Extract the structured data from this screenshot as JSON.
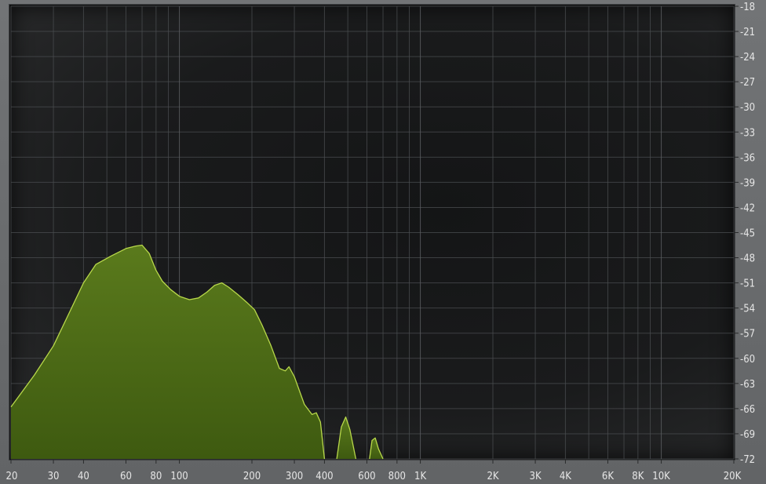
{
  "chart_data": {
    "type": "area",
    "x_scale": "log",
    "y_unit": "dB",
    "xlim": [
      20,
      20000
    ],
    "ylim": [
      -72,
      -18
    ],
    "grid": true,
    "x_ticks": [
      {
        "value": 20,
        "label": "20"
      },
      {
        "value": 30,
        "label": "30"
      },
      {
        "value": 40,
        "label": "40"
      },
      {
        "value": 60,
        "label": "60"
      },
      {
        "value": 80,
        "label": "80"
      },
      {
        "value": 100,
        "label": "100"
      },
      {
        "value": 200,
        "label": "200"
      },
      {
        "value": 300,
        "label": "300"
      },
      {
        "value": 400,
        "label": "400"
      },
      {
        "value": 600,
        "label": "600"
      },
      {
        "value": 800,
        "label": "800"
      },
      {
        "value": 1000,
        "label": "1K"
      },
      {
        "value": 2000,
        "label": "2K"
      },
      {
        "value": 3000,
        "label": "3K"
      },
      {
        "value": 4000,
        "label": "4K"
      },
      {
        "value": 6000,
        "label": "6K"
      },
      {
        "value": 8000,
        "label": "8K"
      },
      {
        "value": 10000,
        "label": "10K"
      },
      {
        "value": 20000,
        "label": "20K"
      }
    ],
    "x_grid_minor": [
      50,
      70,
      90,
      500,
      700,
      900,
      5000,
      7000,
      9000
    ],
    "y_ticks": [
      {
        "value": -18,
        "label": "-18"
      },
      {
        "value": -21,
        "label": "-21"
      },
      {
        "value": -24,
        "label": "-24"
      },
      {
        "value": -27,
        "label": "-27"
      },
      {
        "value": -30,
        "label": "-30"
      },
      {
        "value": -33,
        "label": "-33"
      },
      {
        "value": -36,
        "label": "-36"
      },
      {
        "value": -39,
        "label": "-39"
      },
      {
        "value": -42,
        "label": "-42"
      },
      {
        "value": -45,
        "label": "-45"
      },
      {
        "value": -48,
        "label": "-48"
      },
      {
        "value": -51,
        "label": "-51"
      },
      {
        "value": -54,
        "label": "-54"
      },
      {
        "value": -57,
        "label": "-57"
      },
      {
        "value": -60,
        "label": "-60"
      },
      {
        "value": -63,
        "label": "-63"
      },
      {
        "value": -66,
        "label": "-66"
      },
      {
        "value": -69,
        "label": "-69"
      },
      {
        "value": -72,
        "label": "-72"
      }
    ],
    "series": [
      {
        "color": "#b8d84a",
        "fill_top": "#5a7a1c",
        "fill_bottom": "#3e5a10",
        "segments": [
          [
            [
              20,
              -65.8
            ],
            [
              25,
              -62.0
            ],
            [
              30,
              -58.5
            ],
            [
              35,
              -54.5
            ],
            [
              40,
              -51.0
            ],
            [
              45,
              -48.8
            ],
            [
              52,
              -47.8
            ],
            [
              60,
              -46.9
            ],
            [
              66,
              -46.6
            ],
            [
              70,
              -46.5
            ],
            [
              75,
              -47.5
            ],
            [
              80,
              -49.5
            ],
            [
              85,
              -50.8
            ],
            [
              92,
              -51.8
            ],
            [
              100,
              -52.6
            ],
            [
              110,
              -53.0
            ],
            [
              120,
              -52.8
            ],
            [
              130,
              -52.1
            ],
            [
              140,
              -51.3
            ],
            [
              150,
              -51.0
            ],
            [
              160,
              -51.5
            ],
            [
              175,
              -52.4
            ],
            [
              190,
              -53.3
            ],
            [
              205,
              -54.2
            ],
            [
              220,
              -56.0
            ],
            [
              240,
              -58.5
            ],
            [
              260,
              -61.2
            ],
            [
              275,
              -61.5
            ],
            [
              285,
              -61.0
            ],
            [
              300,
              -62.2
            ],
            [
              330,
              -65.5
            ],
            [
              355,
              -66.7
            ],
            [
              370,
              -66.5
            ],
            [
              385,
              -67.6
            ],
            [
              400,
              -72.0
            ]
          ],
          [
            [
              450,
              -72.0
            ],
            [
              470,
              -68.2
            ],
            [
              490,
              -67.0
            ],
            [
              510,
              -68.5
            ],
            [
              540,
              -72.0
            ]
          ],
          [
            [
              615,
              -72.0
            ],
            [
              630,
              -69.8
            ],
            [
              650,
              -69.5
            ],
            [
              670,
              -70.8
            ],
            [
              700,
              -72.0
            ]
          ]
        ]
      }
    ]
  }
}
